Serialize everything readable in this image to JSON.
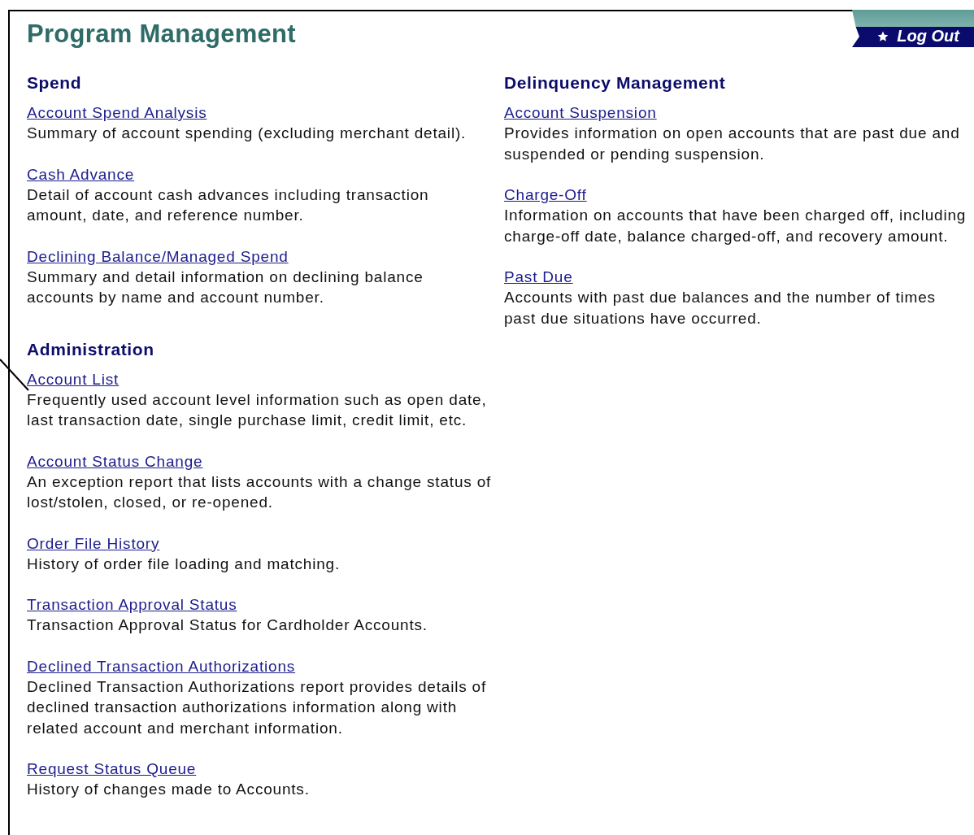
{
  "title": "Program Management",
  "logout": {
    "label": "Log Out"
  },
  "columns": [
    {
      "sections": [
        {
          "heading": "Spend",
          "items": [
            {
              "link": "Account Spend Analysis",
              "description": "Summary of account spending (excluding merchant detail)."
            },
            {
              "link": "Cash Advance",
              "description": "Detail of account cash advances including transaction amount, date, and reference number."
            },
            {
              "link": "Declining Balance/Managed Spend",
              "description": "Summary and detail information on declining balance accounts by name and account number."
            }
          ]
        },
        {
          "heading": "Administration",
          "items": [
            {
              "link": "Account List",
              "description": "Frequently used account level information such as open date, last transaction date, single purchase limit, credit limit, etc."
            },
            {
              "link": "Account Status Change",
              "description": "An exception report that lists accounts with a change status of lost/stolen, closed, or re-opened."
            },
            {
              "link": "Order File History",
              "description": "History of order file loading and matching."
            },
            {
              "link": "Transaction Approval Status",
              "description": "Transaction Approval Status for Cardholder Accounts."
            },
            {
              "link": "Declined Transaction Authorizations",
              "description": "Declined Transaction Authorizations report provides details of declined transaction authorizations information along with related account and merchant information."
            },
            {
              "link": "Request Status Queue",
              "description": "History of changes made to Accounts."
            }
          ]
        }
      ]
    },
    {
      "sections": [
        {
          "heading": "Delinquency Management",
          "items": [
            {
              "link": "Account Suspension",
              "description": "Provides information on open accounts that are past due and suspended or pending suspension."
            },
            {
              "link": "Charge-Off",
              "description": "Information on accounts that have been charged off, including charge-off date, balance charged-off, and recovery amount."
            },
            {
              "link": "Past Due",
              "description": "Accounts with past due balances and the number of times past due situations have occurred."
            }
          ]
        }
      ]
    }
  ]
}
